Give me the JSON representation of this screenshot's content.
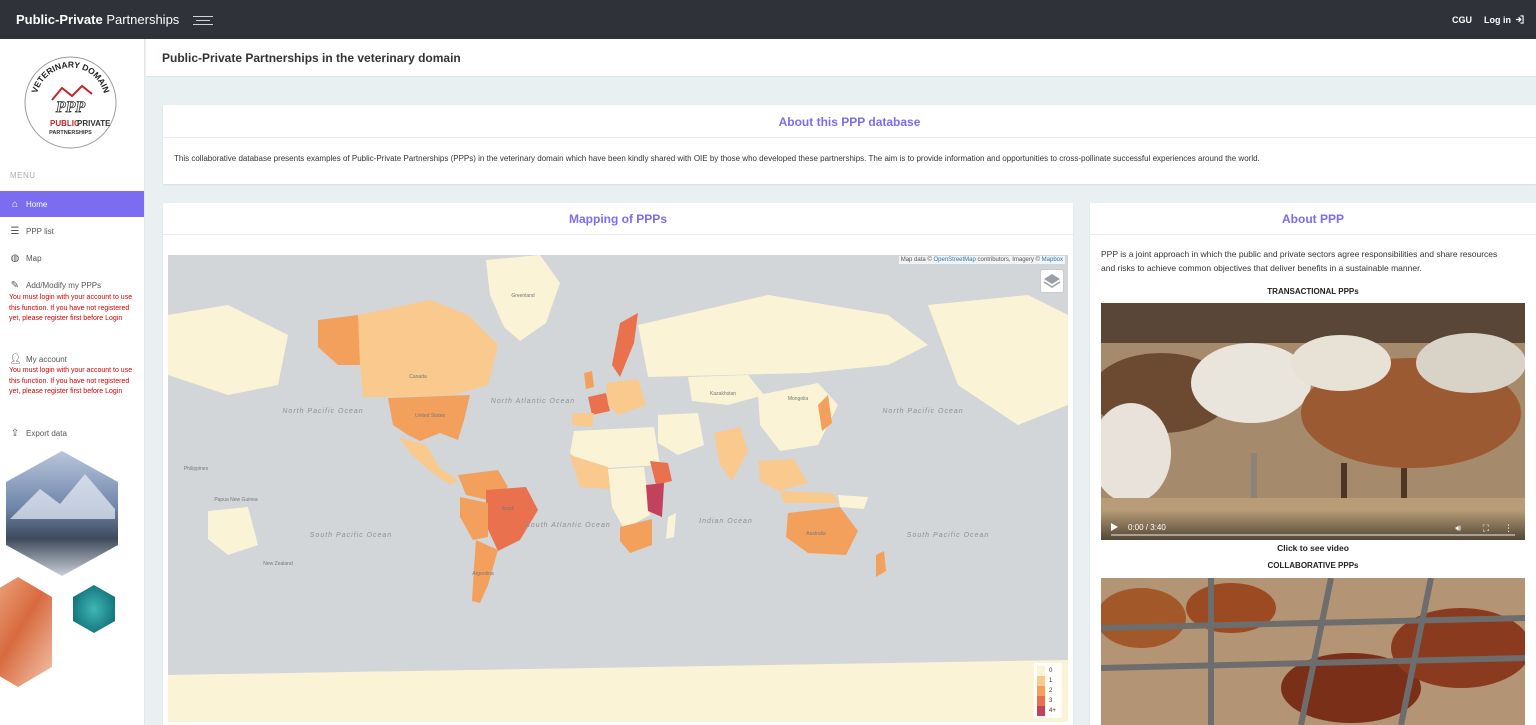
{
  "header": {
    "brand_bold": "Public-Private",
    "brand_rest": " Partnerships",
    "user": "CGU",
    "login": "Log in"
  },
  "logo": {
    "arc_text": "VETERINARY DOMAIN",
    "line1_a": "PUBLIC",
    "line1_b": "PRIVATE",
    "line2": "PARTNERSHIPS",
    "monogram": "PPP"
  },
  "sidebar": {
    "menu_label": "MENU",
    "items": [
      {
        "label": "Home",
        "icon": "home-icon"
      },
      {
        "label": "PPP list",
        "icon": "list-icon"
      },
      {
        "label": "Map",
        "icon": "globe-icon"
      },
      {
        "label": "Add/Modify my PPPs",
        "icon": "pencil-icon"
      },
      {
        "label": "My account",
        "icon": "user-icon"
      },
      {
        "label": "Export data",
        "icon": "upload-icon"
      }
    ],
    "login_warning": "You must login with your account to use this function. If you have not registered yet, please register first before Login"
  },
  "page": {
    "title": "Public-Private Partnerships in the veterinary domain"
  },
  "about_db": {
    "title": "About this PPP database",
    "text": "This collaborative database presents examples of Public-Private Partnerships (PPPs) in the veterinary domain which have been kindly shared with OIE by those who developed these partnerships. The aim is to provide information and opportunities to cross-pollinate successful experiences around the world."
  },
  "mapping": {
    "title": "Mapping of PPPs",
    "attribution_prefix": "Map data © ",
    "attribution_osm": "OpenStreetMap",
    "attribution_mid": " contributors, Imagery © ",
    "attribution_mapbox": "Mapbox",
    "ocean_labels": [
      "North Pacific Ocean",
      "North Atlantic Ocean",
      "South Pacific Ocean",
      "South Atlantic Ocean",
      "Indian Ocean",
      "North Pacific Ocean",
      "South Pacific Ocean"
    ],
    "place_labels": [
      "Canada",
      "United States",
      "Brazil",
      "Australia",
      "Greenland",
      "Kazakhstan",
      "Mongolia",
      "Argentina",
      "Philippines",
      "Papua New Guinea",
      "New Zealand"
    ],
    "legend": [
      {
        "label": "0",
        "color": "#fbf3d5"
      },
      {
        "label": "1",
        "color": "#f9c98e"
      },
      {
        "label": "2",
        "color": "#f3a05d"
      },
      {
        "label": "3",
        "color": "#e9714d"
      },
      {
        "label": "4+",
        "color": "#c2415b"
      }
    ]
  },
  "about_ppp": {
    "title": "About PPP",
    "text": "PPP is a joint approach in which the public and private sectors agree responsibilities and share resources and risks to achieve common objectives that deliver benefits in a sustainable manner.",
    "transactional_label": "TRANSACTIONAL PPPs",
    "video_time": "0:00 / 3:40",
    "video_caption": "Click to see video",
    "collaborative_label": "COLLABORATIVE PPPs"
  }
}
